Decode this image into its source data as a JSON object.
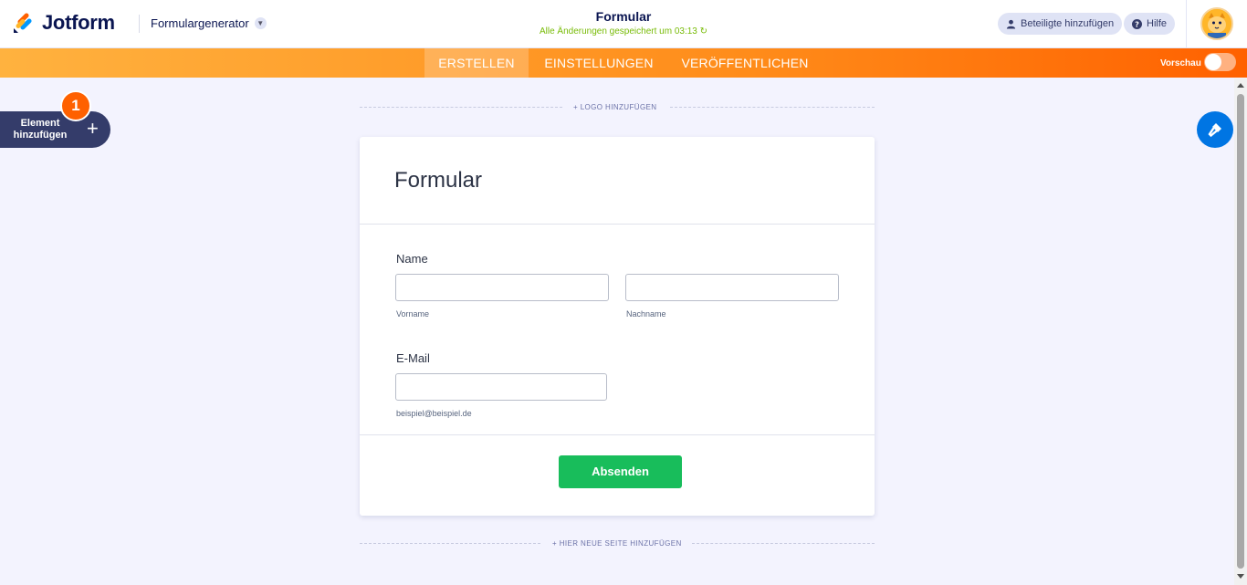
{
  "header": {
    "brand": "Jotform",
    "builder_menu": "Formulargenerator",
    "form_title": "Formular",
    "save_status": "Alle Änderungen gespeichert um 03:13",
    "add_participants": "Beteiligte hinzufügen",
    "help": "Hilfe"
  },
  "nav": {
    "tabs": [
      {
        "label": "ERSTELLEN",
        "active": true
      },
      {
        "label": "EINSTELLUNGEN",
        "active": false
      },
      {
        "label": "VERÖFFENTLICHEN",
        "active": false
      }
    ],
    "preview_label": "Vorschau",
    "preview_enabled": false
  },
  "sidebar": {
    "add_element_label": "Element hinzufügen",
    "step_badge": "1"
  },
  "canvas": {
    "add_logo": "+ LOGO HINZUFÜGEN",
    "add_page": "+ HIER NEUE SEITE HINZUFÜGEN"
  },
  "form": {
    "heading": "Formular",
    "name_label": "Name",
    "first_name_sublabel": "Vorname",
    "last_name_sublabel": "Nachname",
    "first_name_value": "",
    "last_name_value": "",
    "email_label": "E-Mail",
    "email_value": "",
    "email_sublabel": "beispiel@beispiel.de",
    "submit_label": "Absenden"
  },
  "colors": {
    "accent_orange": "#ff6100",
    "submit_green": "#18bd5b",
    "designer_blue": "#0075e3",
    "navy": "#0a1551"
  },
  "icons": {
    "logo": "jotform-logo-icon",
    "menu": "chevron-down-icon",
    "refresh": "refresh-icon",
    "participants": "user-icon",
    "help": "help-circle-icon",
    "add": "plus-icon",
    "designer": "paint-roller-icon"
  }
}
